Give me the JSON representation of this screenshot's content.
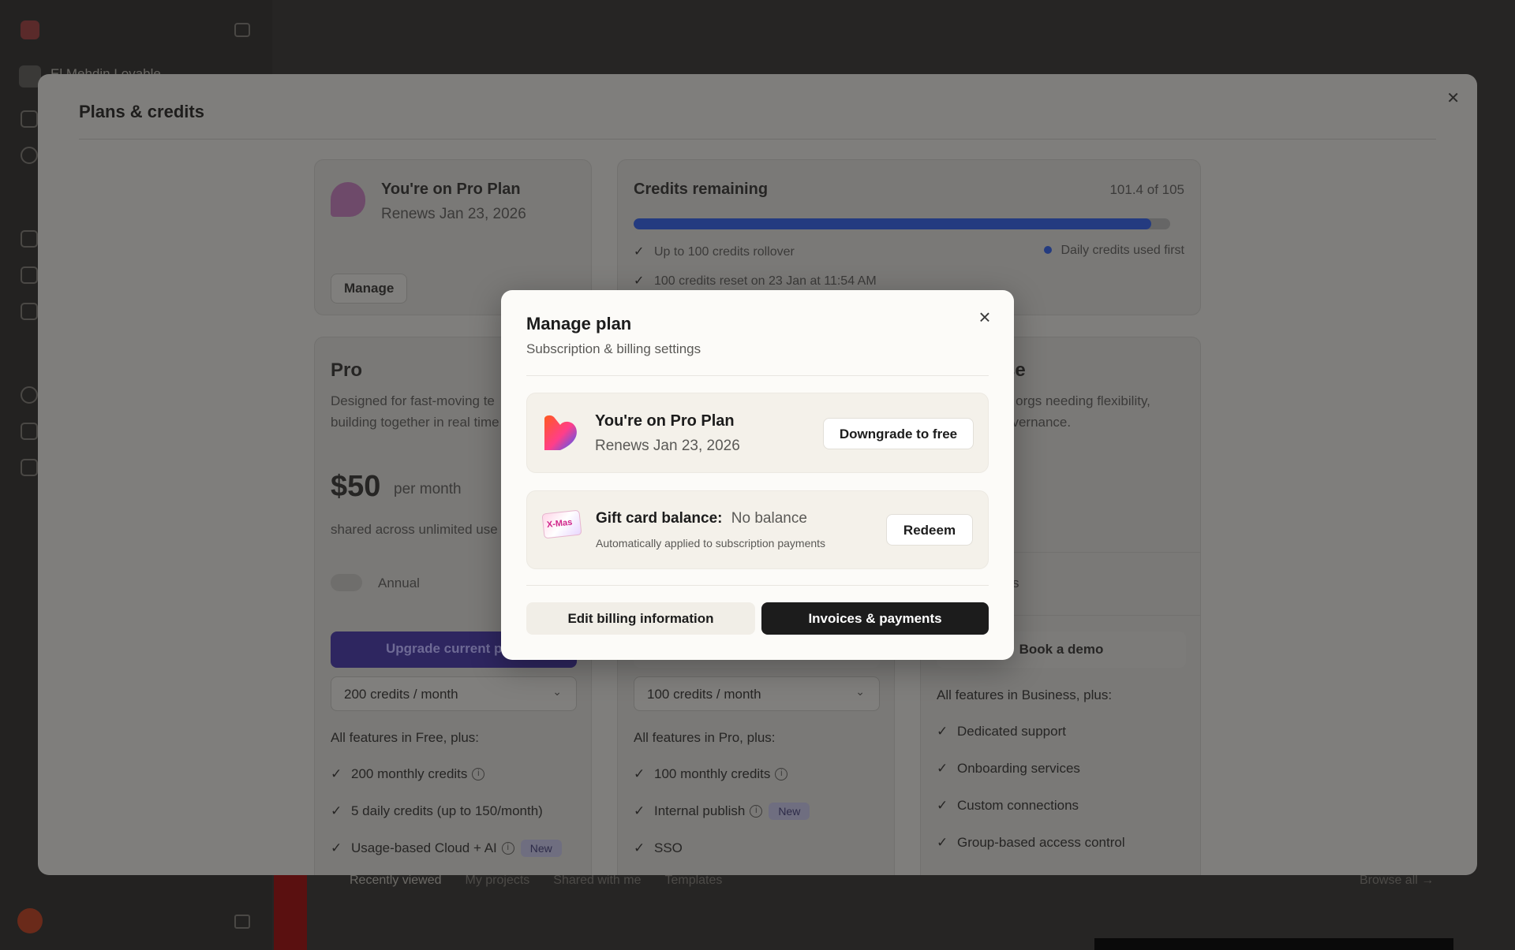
{
  "background": {
    "workspace_name": "El Mehdin Lovable",
    "tabs": [
      "Recently viewed",
      "My projects",
      "Shared with me",
      "Templates"
    ],
    "browse_all": "Browse all"
  },
  "plans_dialog": {
    "title": "Plans & credits",
    "current_plan": {
      "title": "You're on Pro Plan",
      "renews": "Renews Jan 23, 2026",
      "manage_label": "Manage"
    },
    "credits": {
      "title": "Credits remaining",
      "amount": "101.4 of 105",
      "used_fraction": 0.965,
      "rollover": "Up to 100 credits rollover",
      "daily_first": "Daily credits used first",
      "reset": "100 credits reset on 23 Jan at 11:54 AM"
    },
    "pro": {
      "name": "Pro",
      "desc_line1": "Designed for fast-moving te",
      "desc_line2": "building together in real time",
      "price": "$50",
      "period": "per month",
      "shared": "shared across unlimited use",
      "annual_label": "Annual",
      "upgrade_label": "Upgrade current p",
      "credits_select": "200 credits / month",
      "features_heading": "All features in Free, plus:",
      "features": [
        "200 monthly credits",
        "5 daily credits (up to 150/month)",
        "Usage-based Cloud + AI"
      ],
      "new_badge": "New"
    },
    "business": {
      "credits_select": "100 credits / month",
      "features_heading": "All features in Pro, plus:",
      "features": [
        "100 monthly credits",
        "Internal publish",
        "SSO"
      ],
      "new_badge": "New"
    },
    "enterprise": {
      "name_tail": "se",
      "desc_line1": "e orgs needing flexibility,",
      "desc_line2": "overnance.",
      "toggle_tail": "s",
      "demo_label": "Book a demo",
      "features_heading": "All features in Business, plus:",
      "features": [
        "Dedicated support",
        "Onboarding services",
        "Custom connections",
        "Group-based access control"
      ]
    }
  },
  "manage_modal": {
    "title": "Manage plan",
    "subtitle": "Subscription & billing settings",
    "plan": {
      "title": "You're on Pro Plan",
      "renews": "Renews Jan 23, 2026",
      "downgrade_label": "Downgrade to free"
    },
    "gift": {
      "label": "Gift card balance:",
      "value": "No balance",
      "note": "Automatically applied to subscription payments",
      "redeem_label": "Redeem",
      "card_text": "X-Mas"
    },
    "edit_billing_label": "Edit billing information",
    "invoices_label": "Invoices & payments"
  },
  "icons": {
    "close": "close-icon",
    "check": "check-icon",
    "info": "info-icon",
    "chevron": "chevron-down-icon",
    "heart_logo": "heart-logo-icon",
    "gift_card": "gift-card-icon"
  },
  "colors": {
    "primary_dark": "#1c1c1c",
    "credits_bar": "#243b80",
    "upgrade_button": "#2e2660"
  }
}
